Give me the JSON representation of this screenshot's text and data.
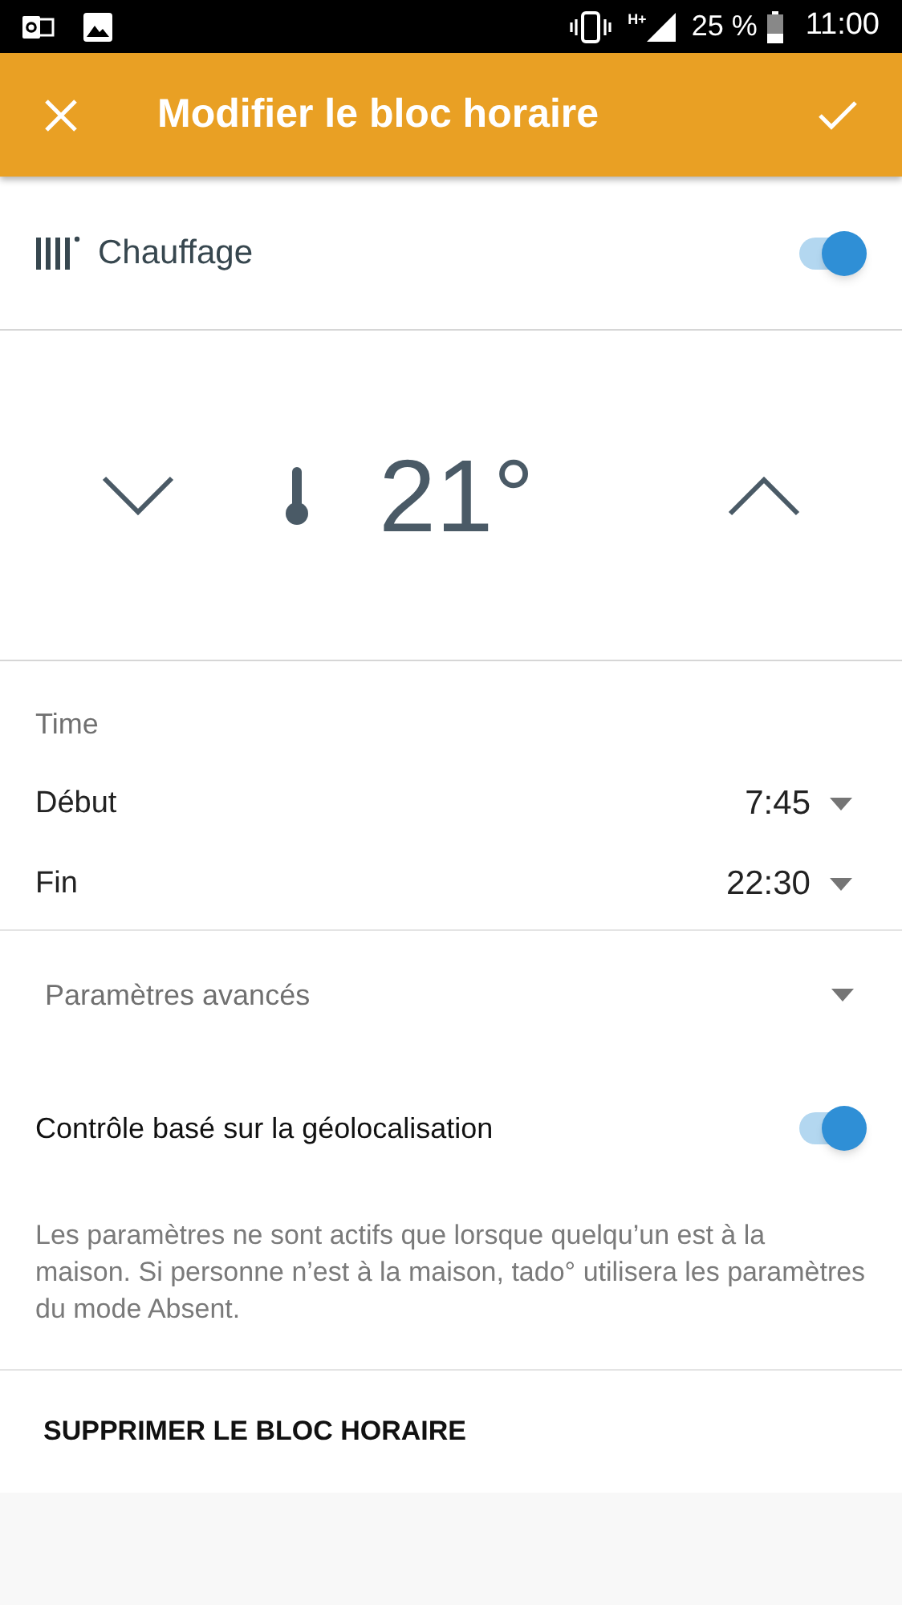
{
  "status_bar": {
    "network": "H+",
    "battery": "25 %",
    "time": "11:00"
  },
  "app_bar": {
    "title": "Modifier le bloc horaire"
  },
  "heating": {
    "label": "Chauffage",
    "on": true
  },
  "temperature": {
    "value": "21°"
  },
  "time": {
    "heading": "Time",
    "rows": [
      {
        "label": "Début",
        "value": "7:45"
      },
      {
        "label": "Fin",
        "value": "22:30"
      }
    ]
  },
  "advanced": {
    "label": "Paramètres avancés",
    "expanded": false
  },
  "geolocation": {
    "label": "Contrôle basé sur la géolocalisation",
    "on": true,
    "description": "Les paramètres ne sont actifs que lorsque quelqu’un est à la maison. Si personne n’est à la maison, tado° utilisera les paramètres du mode Absent."
  },
  "delete_button": "SUPPRIMER LE BLOC HORAIRE"
}
